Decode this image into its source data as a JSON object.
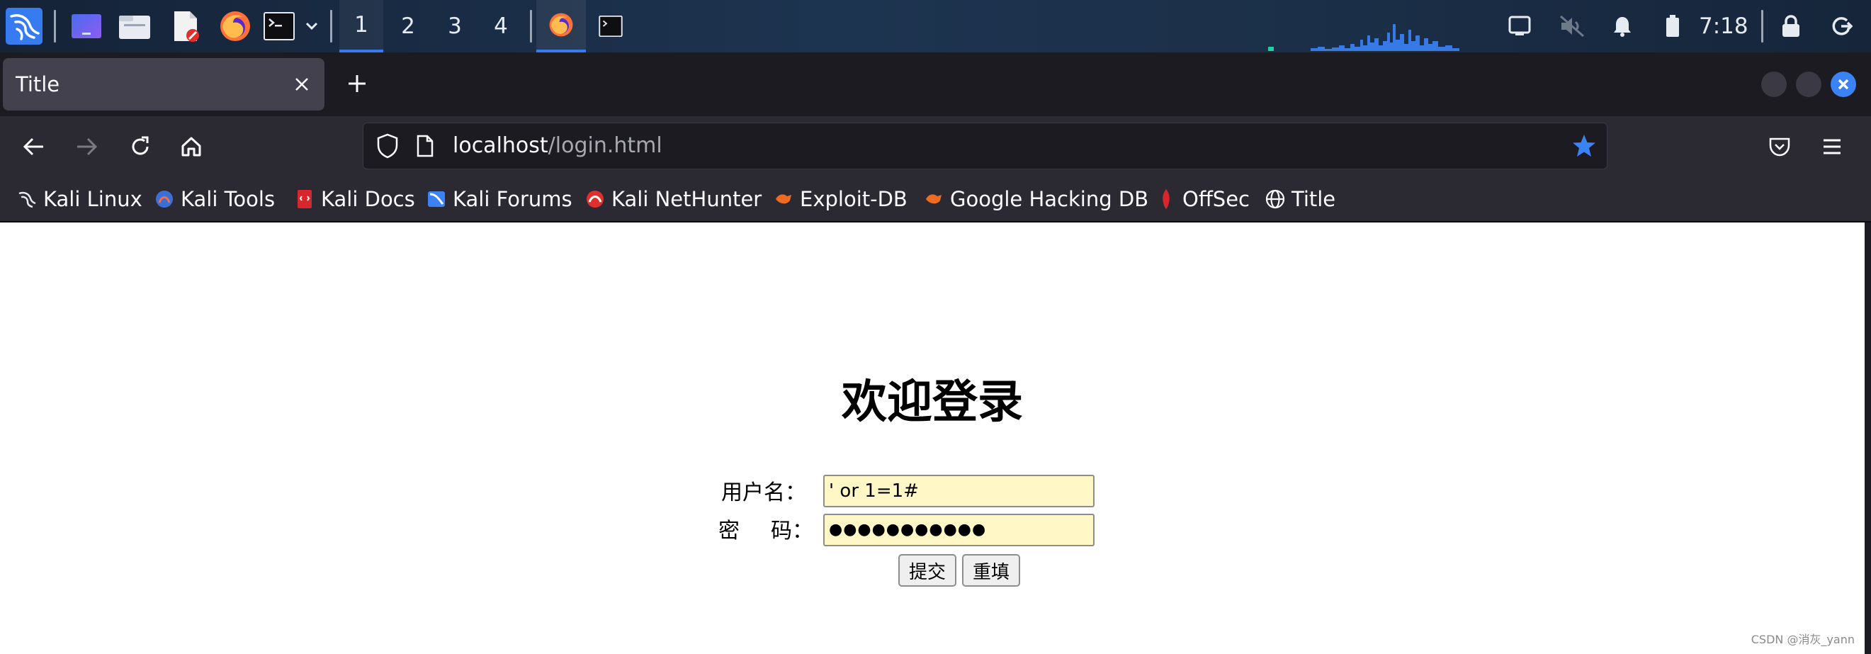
{
  "panel": {
    "workspaces": [
      "1",
      "2",
      "3",
      "4"
    ],
    "active_workspace": "1",
    "clock": "7:18"
  },
  "tab": {
    "title": "Title"
  },
  "urlbar": {
    "host": "localhost",
    "path": "/login.html"
  },
  "bookmarks": [
    "Kali Linux",
    "Kali Tools",
    "Kali Docs",
    "Kali Forums",
    "Kali NetHunter",
    "Exploit-DB",
    "Google Hacking DB",
    "OffSec",
    "Title"
  ],
  "page": {
    "heading": "欢迎登录",
    "username_label": "用户名：",
    "username_value": "' or 1=1#",
    "password_label_1": "密",
    "password_label_2": "码：",
    "password_value": "●●●●●●●●●●●",
    "submit_label": "提交",
    "reset_label": "重填"
  },
  "watermark": "CSDN @消灰_yann",
  "colors": {
    "accent": "#367bf0",
    "tab_active": "#42414d",
    "toolbar": "#2b2a33",
    "input_autofill": "#fff7c6"
  }
}
